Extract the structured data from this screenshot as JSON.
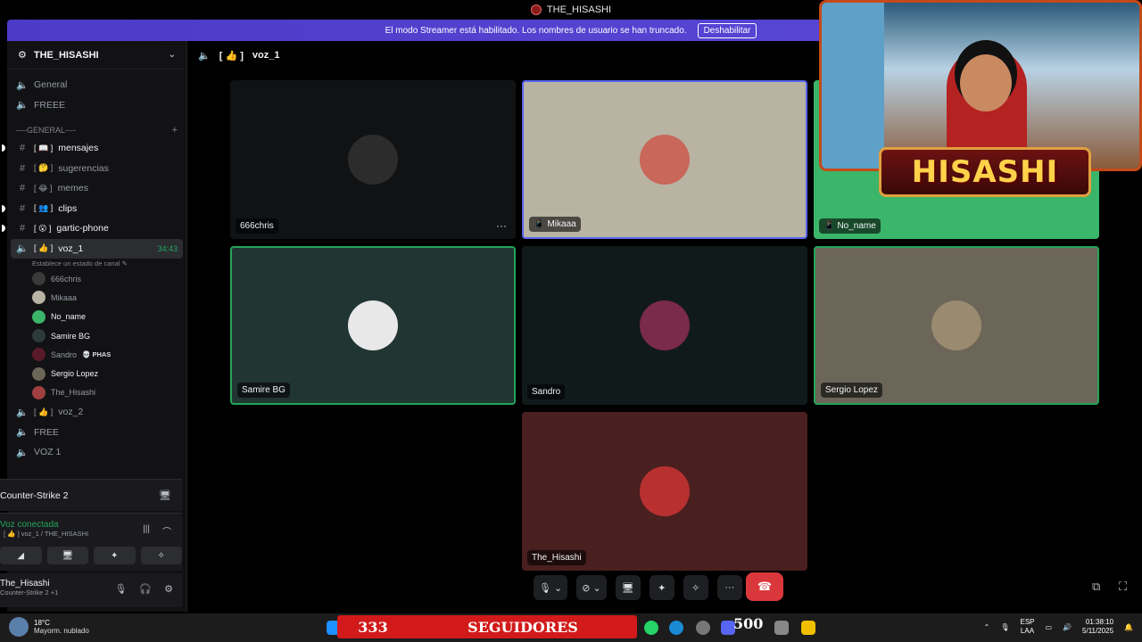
{
  "title": "THE_HISASHI",
  "banner": {
    "text": "El modo Streamer está habilitado. Los nombres de usuario se han truncado.",
    "button": "Deshabilitar"
  },
  "server": {
    "name": "THE_HISASHI"
  },
  "channels_top": [
    {
      "icon": "🔈",
      "name": "General"
    },
    {
      "icon": "🔈",
      "name": "FREEE"
    }
  ],
  "category": "----GENERAL----",
  "text_channels": [
    {
      "name": "mensajes",
      "emoji": "📖",
      "bold": true
    },
    {
      "name": "sugerencias",
      "emoji": "🤔",
      "bold": false
    },
    {
      "name": "memes",
      "emoji": "😂",
      "bold": false
    },
    {
      "name": "clips",
      "emoji": "👥",
      "bold": true
    },
    {
      "name": "gartic-phone",
      "emoji": "😮",
      "bold": true
    }
  ],
  "active_voice": {
    "name": "voz_1",
    "emoji": "👍",
    "time": "34:43",
    "status": "Establece un estado de canal ✎"
  },
  "members": [
    {
      "name": "666chris",
      "bold": false,
      "color": "#3a3a3a"
    },
    {
      "name": "Mikaaa",
      "bold": false,
      "color": "#b9b3a4"
    },
    {
      "name": "No_name",
      "bold": true,
      "color": "#3ab56a"
    },
    {
      "name": "Samire BG",
      "bold": true,
      "color": "#2c3a38"
    },
    {
      "name": "Sandro",
      "bold": false,
      "color": "#5a1a2a",
      "tag": "💀 PHAS"
    },
    {
      "name": "Sergio Lopez",
      "bold": true,
      "color": "#6b6658"
    },
    {
      "name": "The_Hisashi",
      "bold": false,
      "color": "#a04040"
    }
  ],
  "channels_bottom": [
    {
      "icon": "🔈",
      "name": "voz_2",
      "emoji": "👍",
      "prefix": "["
    },
    {
      "icon": "🔈",
      "name": "FREE"
    },
    {
      "icon": "🔈",
      "name": "VOZ 1"
    }
  ],
  "activity": {
    "name": "Counter-Strike 2"
  },
  "voice_panel": {
    "status": "Voz conectada",
    "channel": "[ 👍 ] voz_1 / THE_HISASHI"
  },
  "user_panel": {
    "name": "The_Hisashi",
    "sub": "Counter-Strike 2 +1"
  },
  "main_header": {
    "channel": "voz_1",
    "emoji": "👍"
  },
  "tiles": [
    {
      "name": "666chris",
      "bg": "#111214",
      "avatar": "#2c2c2c",
      "speaking": false,
      "device": "",
      "more": "···"
    },
    {
      "name": "Mikaaa",
      "bg": "#b9b3a4",
      "avatar": "#c8675a",
      "speaking": false,
      "device": "📱",
      "border": "#5865f2"
    },
    {
      "name": "No_name",
      "bg": "#3ab56a",
      "avatar": "#3ab56a",
      "speaking": false,
      "device": "📱"
    },
    {
      "name": "Samire BG",
      "bg": "#213532",
      "avatar": "#e8e8e8",
      "speaking": true,
      "device": ""
    },
    {
      "name": "Sandro",
      "bg": "#111a1a",
      "avatar": "#7a2a4a",
      "speaking": false,
      "device": ""
    },
    {
      "name": "Sergio Lopez",
      "bg": "#6b6658",
      "avatar": "#9a8a70",
      "speaking": true,
      "device": ""
    },
    {
      "name": "The_Hisashi",
      "bg": "#4a1f1f",
      "avatar": "#b83030",
      "speaking": false,
      "device": ""
    }
  ],
  "overlay": {
    "badge": "HISASHI"
  },
  "taskbar": {
    "temp": "18°C",
    "weather": "Mayorm. nublado",
    "followers_count": "333",
    "followers_label": "SEGUIDORES",
    "goal": "500",
    "lang1": "ESP",
    "lang2": "LAA",
    "time": "01:38:10",
    "date": "5/11/2025"
  },
  "colors": {
    "speaking": "#23a559",
    "hangup": "#da373c",
    "banner": "#5865f2"
  }
}
